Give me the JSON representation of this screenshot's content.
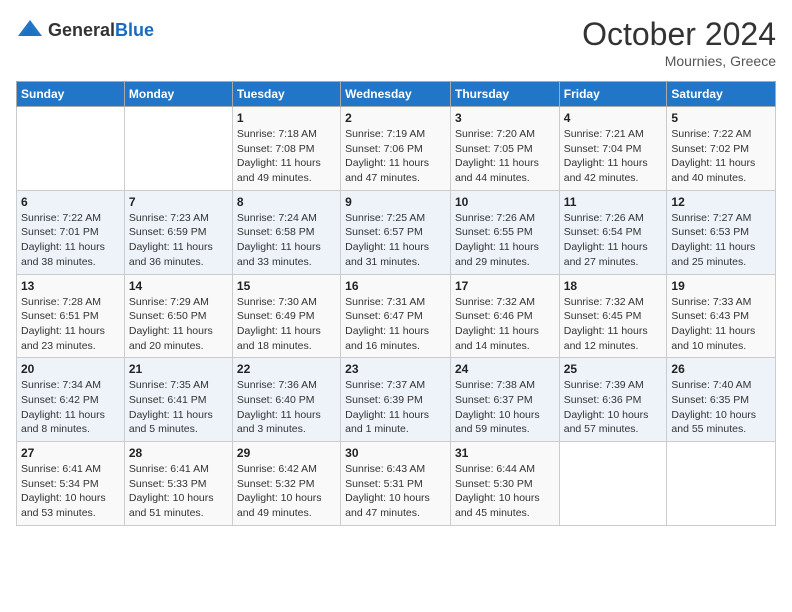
{
  "header": {
    "logo_general": "General",
    "logo_blue": "Blue",
    "month": "October 2024",
    "location": "Mournies, Greece"
  },
  "days_of_week": [
    "Sunday",
    "Monday",
    "Tuesday",
    "Wednesday",
    "Thursday",
    "Friday",
    "Saturday"
  ],
  "weeks": [
    [
      {
        "day": "",
        "sunrise": "",
        "sunset": "",
        "daylight": ""
      },
      {
        "day": "",
        "sunrise": "",
        "sunset": "",
        "daylight": ""
      },
      {
        "day": "1",
        "sunrise": "Sunrise: 7:18 AM",
        "sunset": "Sunset: 7:08 PM",
        "daylight": "Daylight: 11 hours and 49 minutes."
      },
      {
        "day": "2",
        "sunrise": "Sunrise: 7:19 AM",
        "sunset": "Sunset: 7:06 PM",
        "daylight": "Daylight: 11 hours and 47 minutes."
      },
      {
        "day": "3",
        "sunrise": "Sunrise: 7:20 AM",
        "sunset": "Sunset: 7:05 PM",
        "daylight": "Daylight: 11 hours and 44 minutes."
      },
      {
        "day": "4",
        "sunrise": "Sunrise: 7:21 AM",
        "sunset": "Sunset: 7:04 PM",
        "daylight": "Daylight: 11 hours and 42 minutes."
      },
      {
        "day": "5",
        "sunrise": "Sunrise: 7:22 AM",
        "sunset": "Sunset: 7:02 PM",
        "daylight": "Daylight: 11 hours and 40 minutes."
      }
    ],
    [
      {
        "day": "6",
        "sunrise": "Sunrise: 7:22 AM",
        "sunset": "Sunset: 7:01 PM",
        "daylight": "Daylight: 11 hours and 38 minutes."
      },
      {
        "day": "7",
        "sunrise": "Sunrise: 7:23 AM",
        "sunset": "Sunset: 6:59 PM",
        "daylight": "Daylight: 11 hours and 36 minutes."
      },
      {
        "day": "8",
        "sunrise": "Sunrise: 7:24 AM",
        "sunset": "Sunset: 6:58 PM",
        "daylight": "Daylight: 11 hours and 33 minutes."
      },
      {
        "day": "9",
        "sunrise": "Sunrise: 7:25 AM",
        "sunset": "Sunset: 6:57 PM",
        "daylight": "Daylight: 11 hours and 31 minutes."
      },
      {
        "day": "10",
        "sunrise": "Sunrise: 7:26 AM",
        "sunset": "Sunset: 6:55 PM",
        "daylight": "Daylight: 11 hours and 29 minutes."
      },
      {
        "day": "11",
        "sunrise": "Sunrise: 7:26 AM",
        "sunset": "Sunset: 6:54 PM",
        "daylight": "Daylight: 11 hours and 27 minutes."
      },
      {
        "day": "12",
        "sunrise": "Sunrise: 7:27 AM",
        "sunset": "Sunset: 6:53 PM",
        "daylight": "Daylight: 11 hours and 25 minutes."
      }
    ],
    [
      {
        "day": "13",
        "sunrise": "Sunrise: 7:28 AM",
        "sunset": "Sunset: 6:51 PM",
        "daylight": "Daylight: 11 hours and 23 minutes."
      },
      {
        "day": "14",
        "sunrise": "Sunrise: 7:29 AM",
        "sunset": "Sunset: 6:50 PM",
        "daylight": "Daylight: 11 hours and 20 minutes."
      },
      {
        "day": "15",
        "sunrise": "Sunrise: 7:30 AM",
        "sunset": "Sunset: 6:49 PM",
        "daylight": "Daylight: 11 hours and 18 minutes."
      },
      {
        "day": "16",
        "sunrise": "Sunrise: 7:31 AM",
        "sunset": "Sunset: 6:47 PM",
        "daylight": "Daylight: 11 hours and 16 minutes."
      },
      {
        "day": "17",
        "sunrise": "Sunrise: 7:32 AM",
        "sunset": "Sunset: 6:46 PM",
        "daylight": "Daylight: 11 hours and 14 minutes."
      },
      {
        "day": "18",
        "sunrise": "Sunrise: 7:32 AM",
        "sunset": "Sunset: 6:45 PM",
        "daylight": "Daylight: 11 hours and 12 minutes."
      },
      {
        "day": "19",
        "sunrise": "Sunrise: 7:33 AM",
        "sunset": "Sunset: 6:43 PM",
        "daylight": "Daylight: 11 hours and 10 minutes."
      }
    ],
    [
      {
        "day": "20",
        "sunrise": "Sunrise: 7:34 AM",
        "sunset": "Sunset: 6:42 PM",
        "daylight": "Daylight: 11 hours and 8 minutes."
      },
      {
        "day": "21",
        "sunrise": "Sunrise: 7:35 AM",
        "sunset": "Sunset: 6:41 PM",
        "daylight": "Daylight: 11 hours and 5 minutes."
      },
      {
        "day": "22",
        "sunrise": "Sunrise: 7:36 AM",
        "sunset": "Sunset: 6:40 PM",
        "daylight": "Daylight: 11 hours and 3 minutes."
      },
      {
        "day": "23",
        "sunrise": "Sunrise: 7:37 AM",
        "sunset": "Sunset: 6:39 PM",
        "daylight": "Daylight: 11 hours and 1 minute."
      },
      {
        "day": "24",
        "sunrise": "Sunrise: 7:38 AM",
        "sunset": "Sunset: 6:37 PM",
        "daylight": "Daylight: 10 hours and 59 minutes."
      },
      {
        "day": "25",
        "sunrise": "Sunrise: 7:39 AM",
        "sunset": "Sunset: 6:36 PM",
        "daylight": "Daylight: 10 hours and 57 minutes."
      },
      {
        "day": "26",
        "sunrise": "Sunrise: 7:40 AM",
        "sunset": "Sunset: 6:35 PM",
        "daylight": "Daylight: 10 hours and 55 minutes."
      }
    ],
    [
      {
        "day": "27",
        "sunrise": "Sunrise: 6:41 AM",
        "sunset": "Sunset: 5:34 PM",
        "daylight": "Daylight: 10 hours and 53 minutes."
      },
      {
        "day": "28",
        "sunrise": "Sunrise: 6:41 AM",
        "sunset": "Sunset: 5:33 PM",
        "daylight": "Daylight: 10 hours and 51 minutes."
      },
      {
        "day": "29",
        "sunrise": "Sunrise: 6:42 AM",
        "sunset": "Sunset: 5:32 PM",
        "daylight": "Daylight: 10 hours and 49 minutes."
      },
      {
        "day": "30",
        "sunrise": "Sunrise: 6:43 AM",
        "sunset": "Sunset: 5:31 PM",
        "daylight": "Daylight: 10 hours and 47 minutes."
      },
      {
        "day": "31",
        "sunrise": "Sunrise: 6:44 AM",
        "sunset": "Sunset: 5:30 PM",
        "daylight": "Daylight: 10 hours and 45 minutes."
      },
      {
        "day": "",
        "sunrise": "",
        "sunset": "",
        "daylight": ""
      },
      {
        "day": "",
        "sunrise": "",
        "sunset": "",
        "daylight": ""
      }
    ]
  ]
}
